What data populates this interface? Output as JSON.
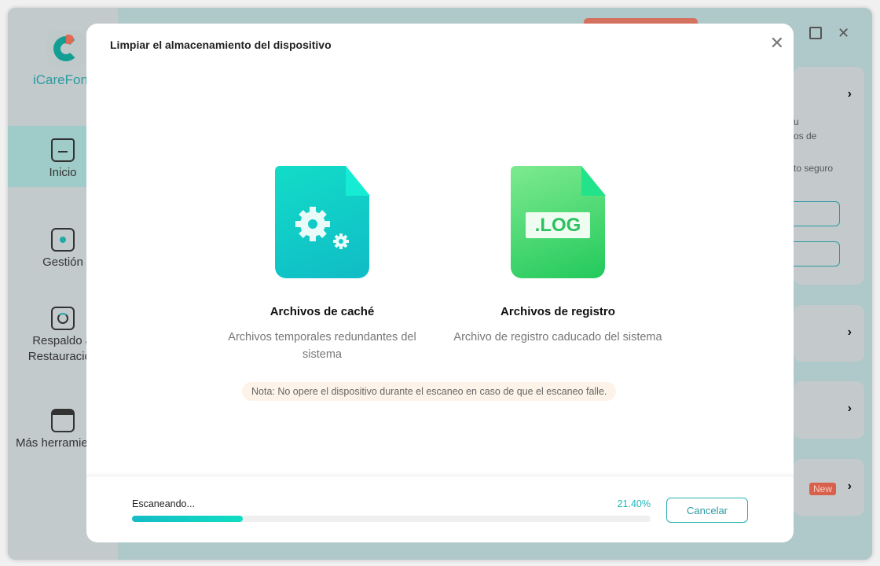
{
  "app": {
    "brand": "iCareFon",
    "accent": "#1fb7b9"
  },
  "sidebar": {
    "items": [
      {
        "label": "Inicio",
        "icon": "home-icon",
        "active": true
      },
      {
        "label": "Gestión",
        "icon": "folder-gear-icon"
      },
      {
        "label": "Respaldo & Restauración",
        "line1": "Respaldo &",
        "line2": "Restauración",
        "icon": "backup-icon"
      },
      {
        "label": "Más herramientas",
        "icon": "toolbox-icon"
      }
    ]
  },
  "background": {
    "text1": "u",
    "text2": "os de",
    "text3": "to seguro",
    "badge": "New"
  },
  "modal": {
    "title": "Limpiar el almacenamiento del dispositivo",
    "items": [
      {
        "title": "Archivos de caché",
        "desc": "Archivos temporales redundantes del sistema",
        "icon": "cache-file-icon"
      },
      {
        "title": "Archivos de registro",
        "desc": "Archivo de registro caducado del sistema",
        "icon": "log-file-icon",
        "tag": ".LOG"
      }
    ],
    "note": "Nota: No opere el dispositivo durante el escaneo en caso de que el escaneo falle.",
    "progress": {
      "label": "Escaneando...",
      "percent_text": "21.40%",
      "percent": 21.4
    },
    "cancel": "Cancelar"
  }
}
